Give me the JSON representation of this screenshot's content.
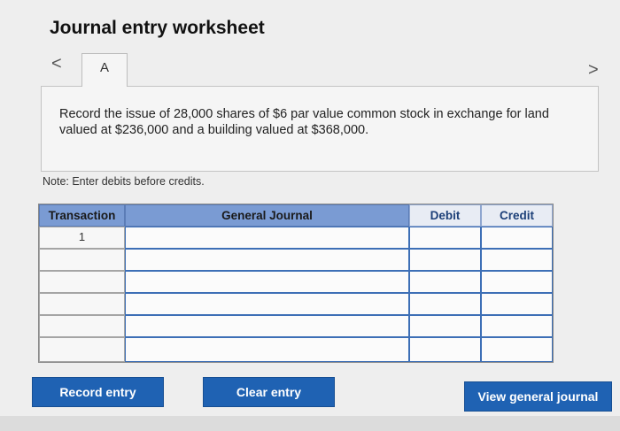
{
  "header": {
    "title": "Journal entry worksheet"
  },
  "nav": {
    "prev_glyph": "<",
    "next_glyph": ">",
    "tab_label": "A"
  },
  "question": {
    "text": "Record the issue of 28,000 shares of $6 par value common stock in exchange for land valued at $236,000 and a building valued at $368,000."
  },
  "note": "Note: Enter debits before credits.",
  "table": {
    "columns": [
      "Transaction",
      "General Journal",
      "Debit",
      "Credit"
    ],
    "rows": [
      {
        "transaction": "1",
        "account": "",
        "debit": "",
        "credit": ""
      },
      {
        "transaction": "",
        "account": "",
        "debit": "",
        "credit": ""
      },
      {
        "transaction": "",
        "account": "",
        "debit": "",
        "credit": ""
      },
      {
        "transaction": "",
        "account": "",
        "debit": "",
        "credit": ""
      },
      {
        "transaction": "",
        "account": "",
        "debit": "",
        "credit": ""
      },
      {
        "transaction": "",
        "account": "",
        "debit": "",
        "credit": ""
      }
    ]
  },
  "buttons": {
    "record": "Record entry",
    "clear": "Clear entry",
    "view": "View general journal"
  },
  "colors": {
    "header_blue": "#7a9bd3",
    "button_blue": "#1f62b3",
    "input_border": "#3d6fb6"
  }
}
